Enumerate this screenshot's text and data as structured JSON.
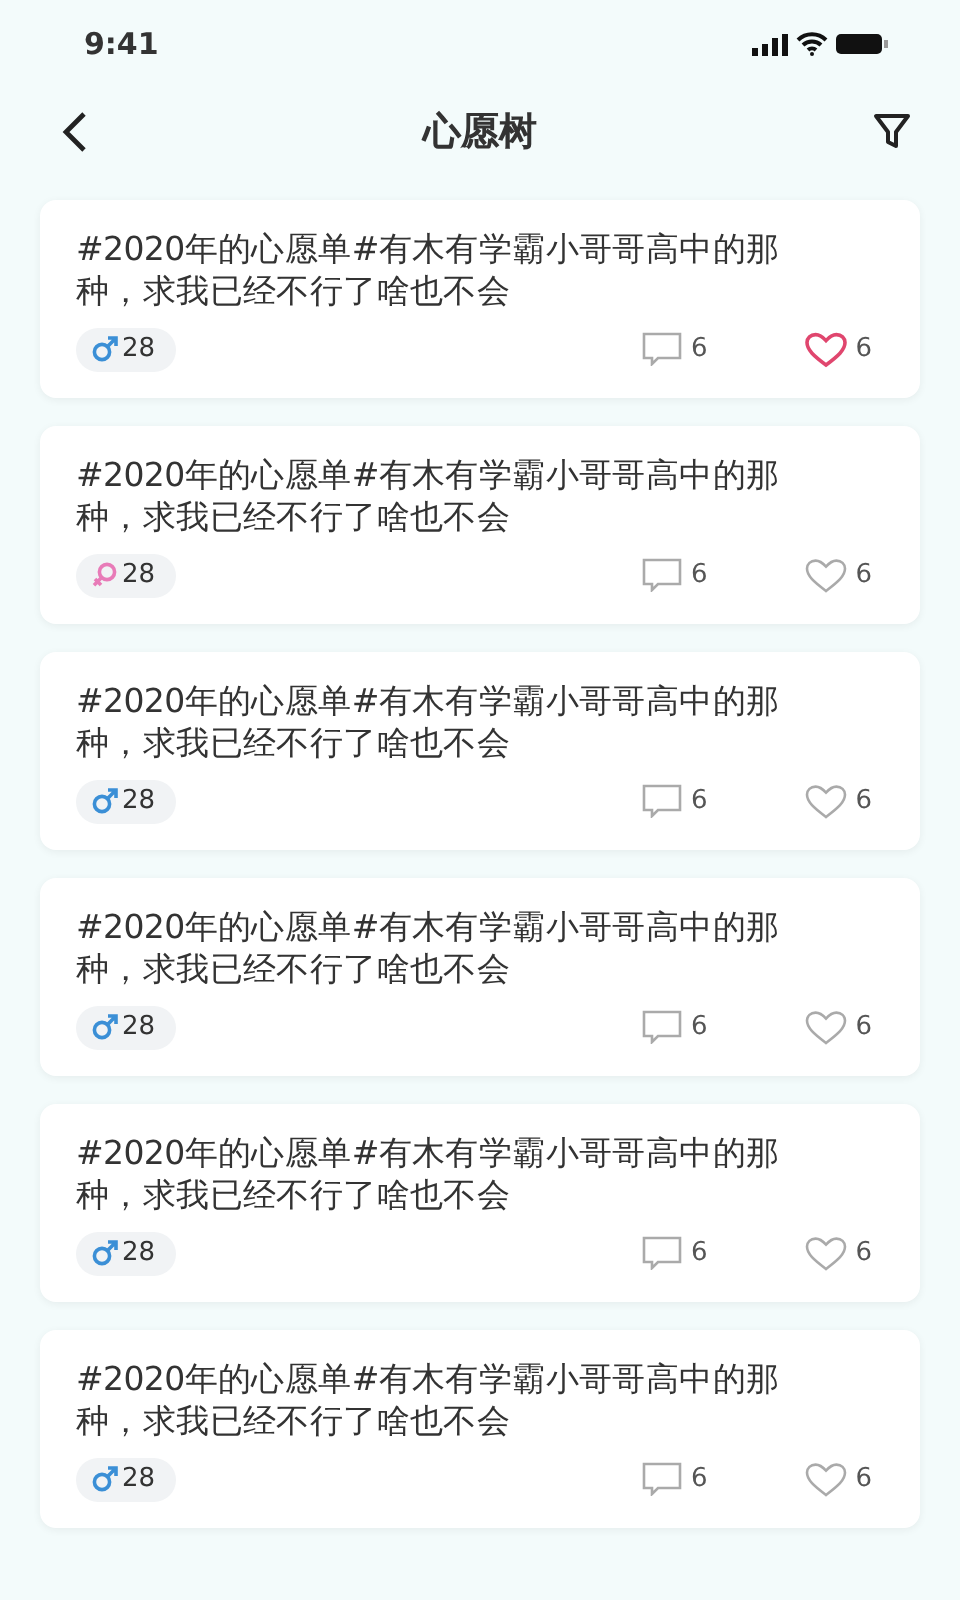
{
  "status_bar": {
    "time": "9:41"
  },
  "header": {
    "title": "心愿树"
  },
  "posts": [
    {
      "text": "#2020年的心愿单#有木有学霸小哥哥高中的那种，求我已经不行了啥也不会",
      "kind": "male",
      "age": "28",
      "comments": "6",
      "likes": "6",
      "liked": true
    },
    {
      "text": "#2020年的心愿单#有木有学霸小哥哥高中的那种，求我已经不行了啥也不会",
      "kind": "female",
      "age": "28",
      "comments": "6",
      "likes": "6",
      "liked": false
    },
    {
      "text": "#2020年的心愿单#有木有学霸小哥哥高中的那种，求我已经不行了啥也不会",
      "kind": "male",
      "age": "28",
      "comments": "6",
      "likes": "6",
      "liked": false
    },
    {
      "text": "#2020年的心愿单#有木有学霸小哥哥高中的那种，求我已经不行了啥也不会",
      "kind": "male",
      "age": "28",
      "comments": "6",
      "likes": "6",
      "liked": false
    },
    {
      "text": "#2020年的心愿单#有木有学霸小哥哥高中的那种，求我已经不行了啥也不会",
      "kind": "male",
      "age": "28",
      "comments": "6",
      "likes": "6",
      "liked": false
    },
    {
      "text": "#2020年的心愿单#有木有学霸小哥哥高中的那种，求我已经不行了啥也不会",
      "kind": "male",
      "age": "28",
      "comments": "6",
      "likes": "6",
      "liked": false
    }
  ]
}
